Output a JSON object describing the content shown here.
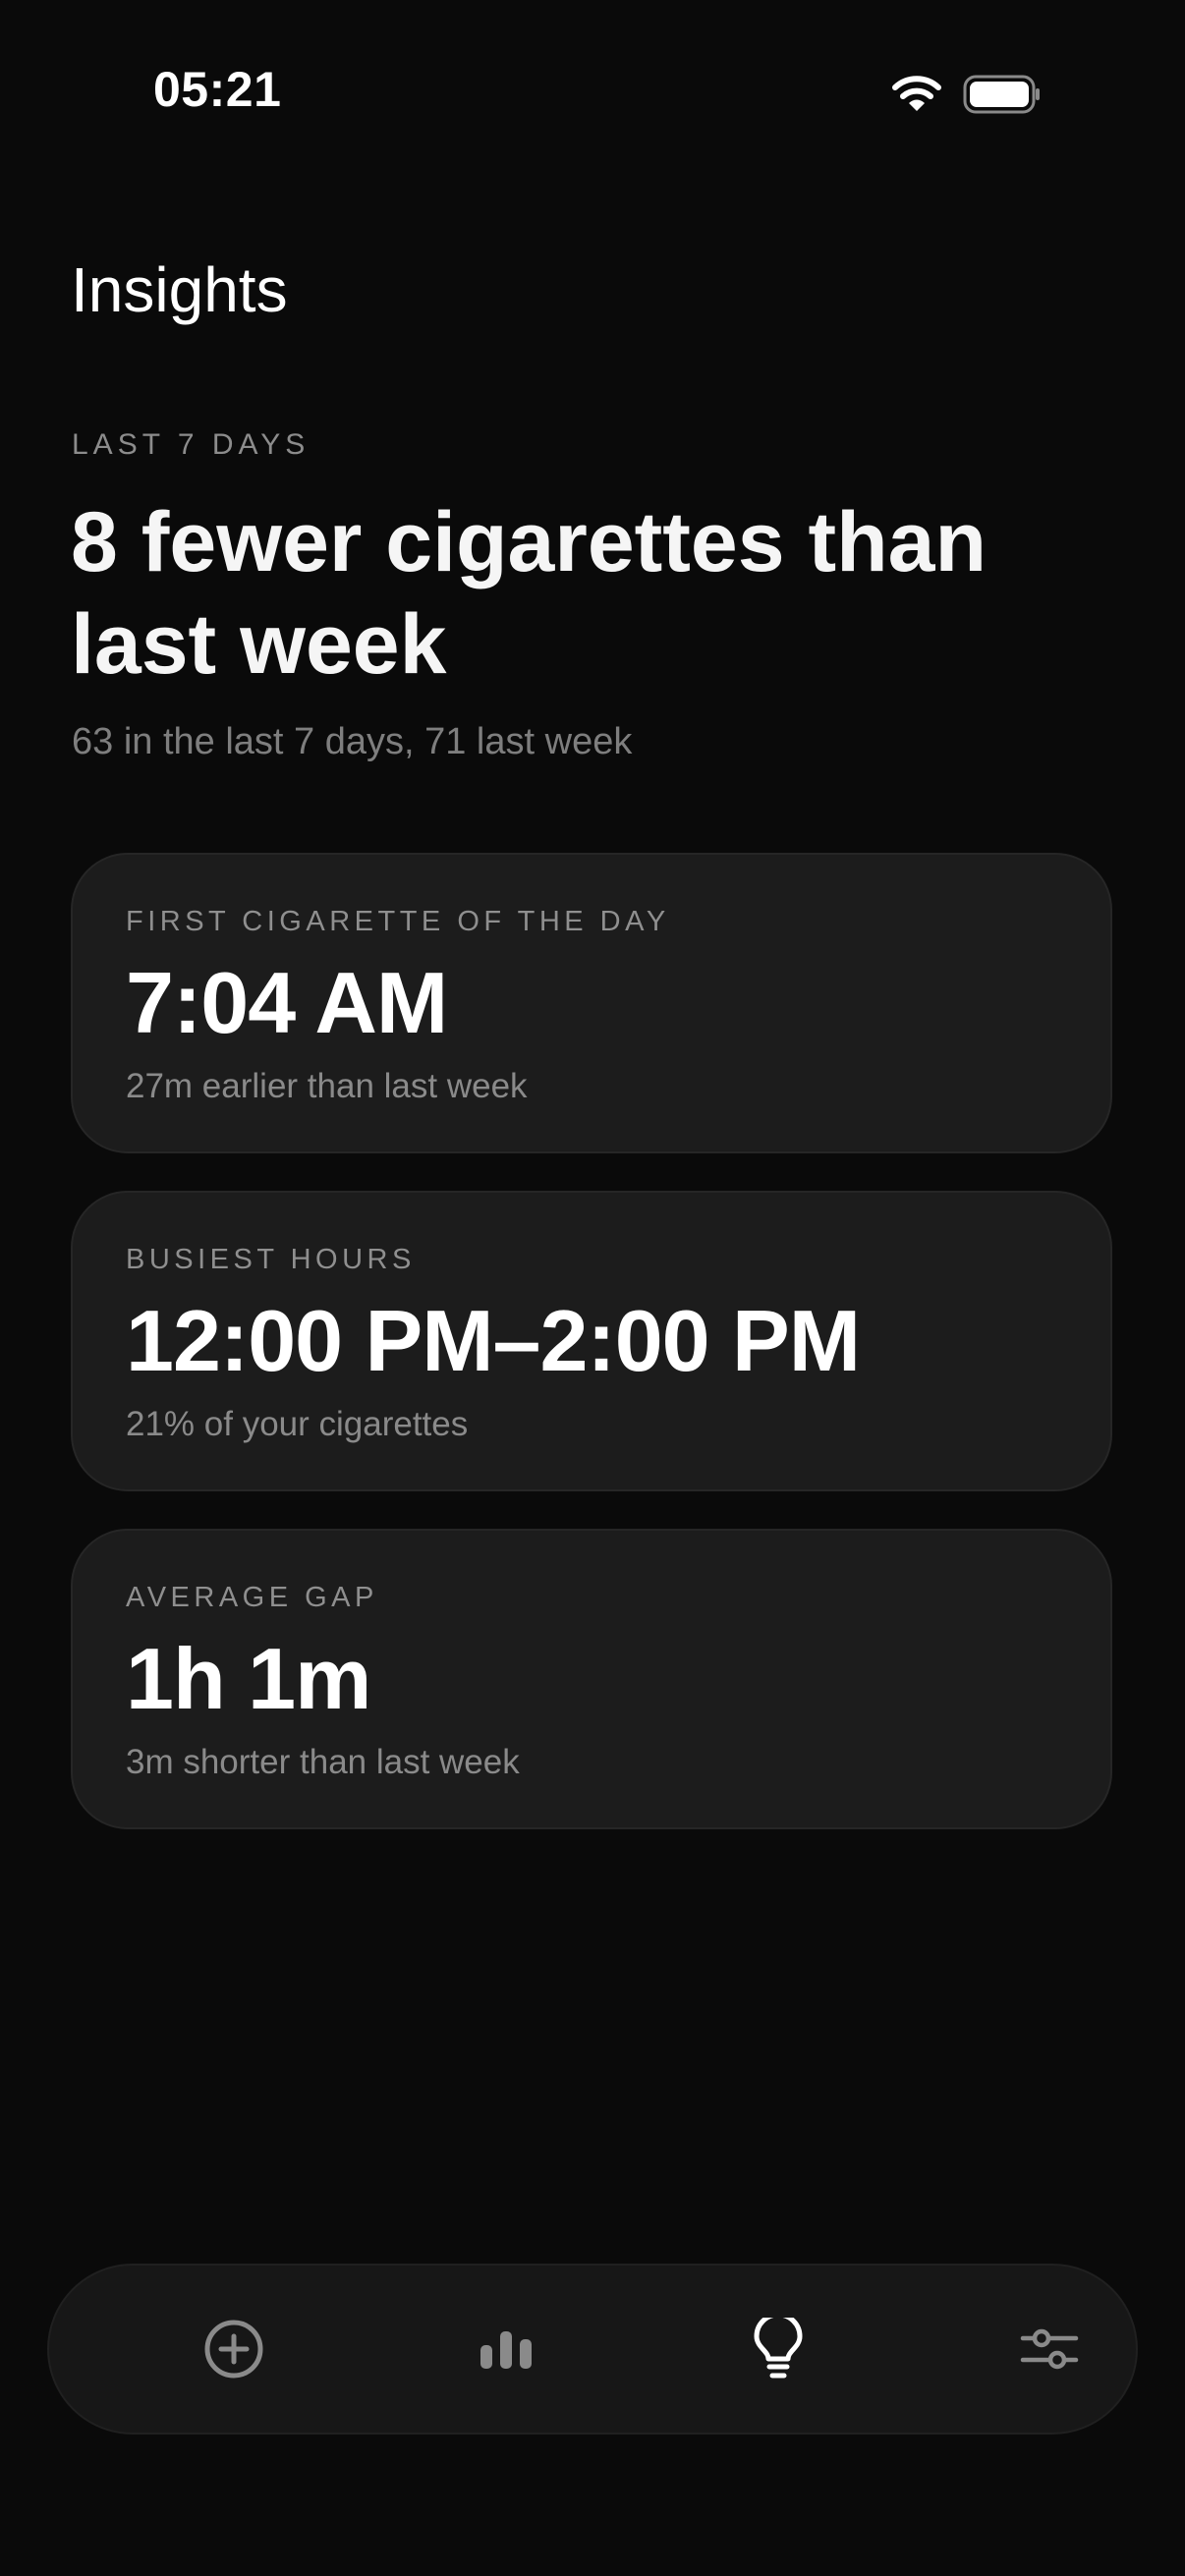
{
  "status_bar": {
    "time": "05:21",
    "icons": [
      "wifi-icon",
      "battery-icon"
    ]
  },
  "page": {
    "title": "Insights"
  },
  "summary": {
    "eyebrow": "LAST 7 DAYS",
    "headline": "8 fewer cigarettes than last week",
    "detail": "63 in the last 7 days, 71 last week"
  },
  "cards": [
    {
      "eyebrow": "FIRST CIGARETTE OF THE DAY",
      "value": "7:04 AM",
      "note": "27m earlier than last week"
    },
    {
      "eyebrow": "BUSIEST HOURS",
      "value": "12:00 PM–2:00 PM",
      "note": "21% of your cigarettes"
    },
    {
      "eyebrow": "AVERAGE GAP",
      "value": "1h 1m",
      "note": "3m shorter than last week"
    }
  ],
  "tab_bar": {
    "items": [
      {
        "icon": "plus-circle-icon",
        "active": false
      },
      {
        "icon": "bar-chart-icon",
        "active": false
      },
      {
        "icon": "lightbulb-icon",
        "active": true
      },
      {
        "icon": "sliders-icon",
        "active": false
      }
    ]
  },
  "colors": {
    "background": "#0a0a0a",
    "card": "#1c1c1c",
    "text_primary": "#f5f5f5",
    "text_secondary": "#8a8a8a",
    "tab_active": "#ffffff",
    "tab_inactive": "#8a8a8a"
  }
}
